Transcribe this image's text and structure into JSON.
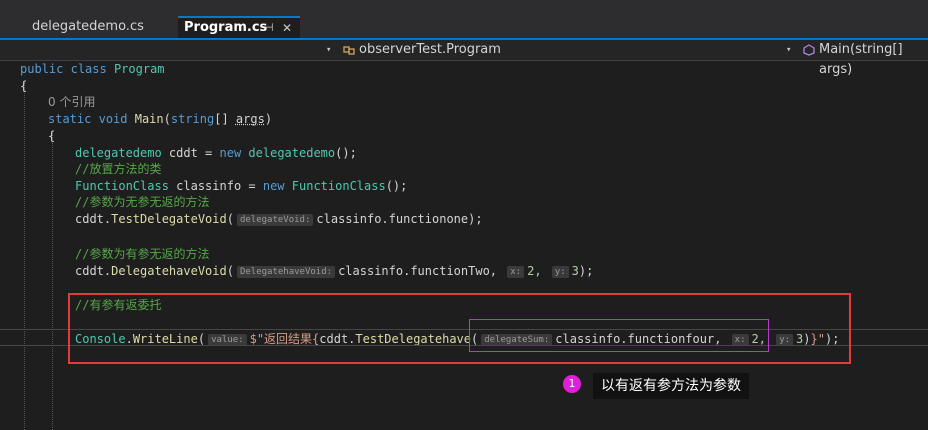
{
  "tabs": [
    {
      "label": "delegatedemo.cs",
      "active": false
    },
    {
      "label": "Program.cs",
      "active": true,
      "pin_glyph": "⊣",
      "close_glyph": "✕"
    }
  ],
  "navbar": {
    "class_dropdown": "observerTest.Program",
    "member_dropdown": "Main(string[] args)",
    "chevron": "▾"
  },
  "code": {
    "l1_kw1": "public",
    "l1_kw2": "class",
    "l1_type": "Program",
    "l2": "{",
    "lens": "0 个引用",
    "l4_kw1": "static",
    "l4_kw2": "void",
    "l4_fn": "Main",
    "l4_open": "(",
    "l4_kw3": "string",
    "l4_rest": "[] ",
    "l4_param": "args",
    "l4_close": ")",
    "l5": "{",
    "l6_type": "delegatedemo",
    "l6_mid": " cddt = ",
    "l6_kw": "new",
    "l6_type2": "delegatedemo",
    "l6_end": "();",
    "l7": "//放置方法的类",
    "l8_type": "FunctionClass",
    "l8_mid": " classinfo = ",
    "l8_kw": "new",
    "l8_type2": "FunctionClass",
    "l8_end": "();",
    "l9": "//参数为无参无返的方法",
    "l10_obj": "cddt.",
    "l10_fn": "TestDelegateVoid",
    "l10_open": "(",
    "l10_hint": "delegateVoid:",
    "l10_arg": "classinfo.functionone",
    "l10_end": ");",
    "l11": "//参数为有参无返的方法",
    "l12_obj": "cddt.",
    "l12_fn": "DelegatehaveVoid",
    "l12_open": "(",
    "l12_hint": "DelegatehaveVoid:",
    "l12_arg": "classinfo.functionTwo,",
    "l12_hint2": "x:",
    "l12_n1": "2,",
    "l12_hint3": "y:",
    "l12_n2": "3",
    "l12_end": ");",
    "l13": "//有参有返委托",
    "l14_type": "Console",
    "l14_dot": ".",
    "l14_fn": "WriteLine",
    "l14_open": "(",
    "l14_hint": "value:",
    "l14_str": "$\"返回结果{",
    "l14_obj": "cddt.",
    "l14_fn2": "TestDelegatehave",
    "l14_open2": "(",
    "l14_hint2": "delegateSum:",
    "l14_arg": "classinfo.functionfour,",
    "l14_hint3": "x:",
    "l14_n1": "2,",
    "l14_hint4": "y:",
    "l14_n2": "3",
    "l14_close": ")",
    "l14_str2": "}\"",
    "l14_end": ");"
  },
  "callout": {
    "badge": "1",
    "text": "以有返有参方法为参数"
  },
  "colors": {
    "highlight_box": "#e03c3c",
    "arg_box": "#b53cc9",
    "badge": "#e020d8"
  }
}
